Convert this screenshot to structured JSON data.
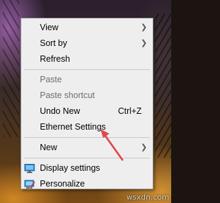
{
  "context_menu": {
    "items": [
      {
        "label": "View",
        "submenu": true
      },
      {
        "label": "Sort by",
        "submenu": true
      },
      {
        "label": "Refresh"
      },
      {
        "label": "Paste",
        "disabled": true
      },
      {
        "label": "Paste shortcut",
        "disabled": true
      },
      {
        "label": "Undo New",
        "shortcut": "Ctrl+Z"
      },
      {
        "label": "Ethernet Settings"
      },
      {
        "label": "New",
        "submenu": true
      },
      {
        "label": "Display settings",
        "icon": "display-icon"
      },
      {
        "label": "Personalize",
        "icon": "personalize-icon"
      }
    ]
  },
  "annotation": {
    "color": "#e0484a"
  },
  "watermark": "wsxdn.com"
}
